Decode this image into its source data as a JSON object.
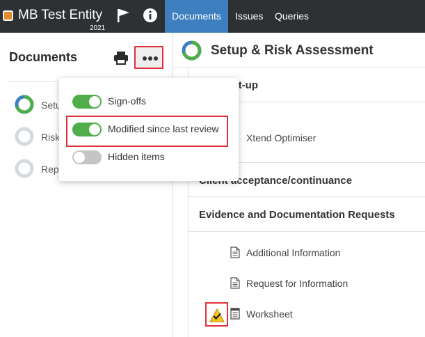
{
  "topbar": {
    "entity_name": "MB Test Entity",
    "entity_year": "2021",
    "entity_color": "#e58a2e",
    "icons": [
      "flag-icon",
      "info-icon"
    ],
    "tabs": [
      {
        "label": "Documents",
        "active": true
      },
      {
        "label": "Issues",
        "active": false
      },
      {
        "label": "Queries",
        "active": false
      }
    ]
  },
  "sidebar": {
    "title": "Documents",
    "icons": [
      "print-icon",
      "more-options-icon"
    ],
    "items": [
      {
        "label": "Setu",
        "progress": 0.7
      },
      {
        "label": "Risk",
        "progress": 0
      },
      {
        "label": "Repo",
        "progress": 0
      }
    ]
  },
  "options_menu": {
    "items": [
      {
        "label": "Sign-offs",
        "enabled": true
      },
      {
        "label": "Modified since last review",
        "enabled": true
      },
      {
        "label": "Hidden items",
        "enabled": false
      }
    ]
  },
  "main": {
    "title": "Setup & Risk Assessment",
    "progress": 0.7,
    "sections": [
      {
        "label": "ment set-up"
      },
      {
        "label": "Client acceptance/continuance"
      },
      {
        "label": "Evidence and Documentation Requests"
      }
    ],
    "documents": [
      {
        "label": "Xtend Optimiser"
      },
      {
        "label": "Additional Information"
      },
      {
        "label": "Request for Information"
      },
      {
        "label": "Worksheet"
      }
    ]
  },
  "colors": {
    "topbar_bg": "#2d3134",
    "active_tab": "#3e7fc0",
    "toggle_on": "#4fae4a",
    "highlight": "#e0303a",
    "progress_ring": "#4fae4a",
    "progress_ring_secondary": "#3e7fc0"
  }
}
